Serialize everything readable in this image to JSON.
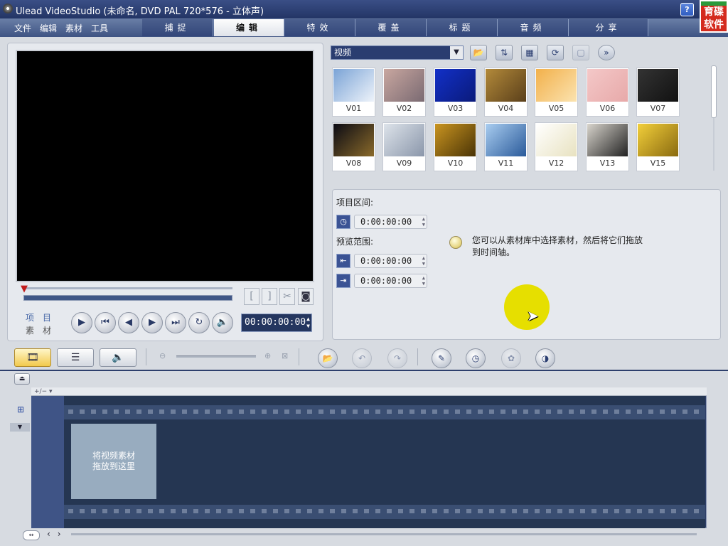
{
  "window": {
    "title": "Ulead VideoStudio (未命名, DVD PAL 720*576 - 立体声)",
    "buttons": [
      "?",
      "_",
      "×"
    ]
  },
  "logo": {
    "line1": "育碟",
    "line2": "软件"
  },
  "menu": {
    "items": [
      "文件",
      "编辑",
      "素材",
      "工具"
    ]
  },
  "tabs": [
    {
      "label": "捕捉",
      "active": false
    },
    {
      "label": "编辑",
      "active": true
    },
    {
      "label": "特效",
      "active": false
    },
    {
      "label": "覆盖",
      "active": false
    },
    {
      "label": "标题",
      "active": false
    },
    {
      "label": "音频",
      "active": false
    },
    {
      "label": "分享",
      "active": false
    }
  ],
  "player": {
    "mode_project": "项目",
    "mode_clip": "素材",
    "timecode": "00:00:00:00",
    "trim_labels": [
      "[",
      "]"
    ]
  },
  "library": {
    "category": "视频",
    "items": [
      {
        "label": "V01",
        "color1": "#7aa3d6",
        "color2": "#eef3fa"
      },
      {
        "label": "V02",
        "color1": "#c9a7a0",
        "color2": "#7a6a72"
      },
      {
        "label": "V03",
        "color1": "#1230c8",
        "color2": "#0a1a7a"
      },
      {
        "label": "V04",
        "color1": "#b38a3a",
        "color2": "#5a3f1a"
      },
      {
        "label": "V05",
        "color1": "#f2b04a",
        "color2": "#fbe3b0"
      },
      {
        "label": "V06",
        "color1": "#f4c8c8",
        "color2": "#e7a9a9"
      },
      {
        "label": "V07",
        "color1": "#333333",
        "color2": "#111111"
      },
      {
        "label": "V08",
        "color1": "#0a0a14",
        "color2": "#8a6a2a"
      },
      {
        "label": "V09",
        "color1": "#dde3ea",
        "color2": "#8a96aa"
      },
      {
        "label": "V10",
        "color1": "#c99420",
        "color2": "#4a3406"
      },
      {
        "label": "V11",
        "color1": "#a9cdf0",
        "color2": "#2a5a9a"
      },
      {
        "label": "V12",
        "color1": "#ffffff",
        "color2": "#e8e2c0"
      },
      {
        "label": "V13",
        "color1": "#d8d4cc",
        "color2": "#222222"
      },
      {
        "label": "V15",
        "color1": "#f2cf3a",
        "color2": "#8a6a10"
      }
    ]
  },
  "options": {
    "project_duration_label": "项目区间:",
    "project_duration_value": "0:00:00:00",
    "preview_range_label": "预览范围:",
    "range_start_value": "0:00:00:00",
    "range_end_value": "0:00:00:00",
    "hint": "您可以从素材库中选择素材，然后将它们拖放到时间轴。"
  },
  "timeline": {
    "drop_hint_line1": "将视频素材",
    "drop_hint_line2": "拖放到这里",
    "header_controls": "+/− ▾"
  },
  "colors": {
    "accent": "#2a3d70",
    "titlebar": "#233565",
    "cursor_highlight": "#e6df00"
  }
}
